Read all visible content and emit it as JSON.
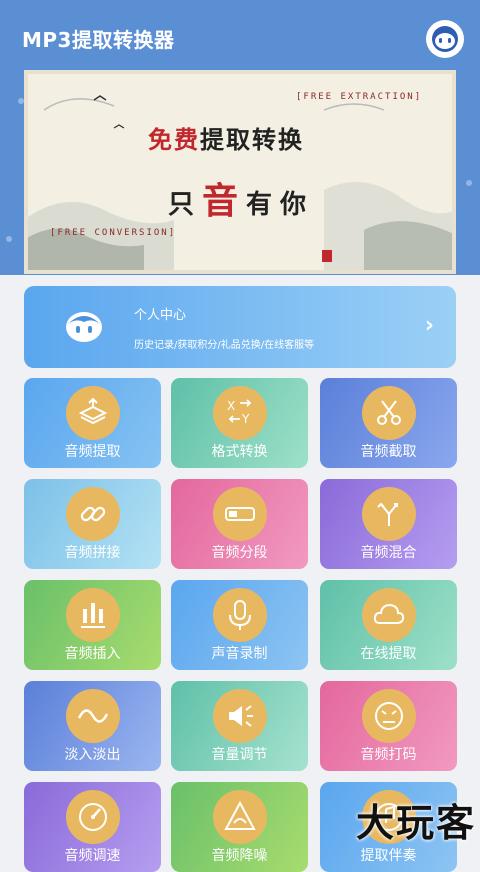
{
  "app": {
    "title": "MP3提取转换器"
  },
  "banner": {
    "tag_top": "[FREE EXTRACTION]",
    "headline_red": "免费",
    "headline_rest": "提取转换",
    "sub_pre": "只",
    "sub_big": "音",
    "sub_post": "有你",
    "tag_bottom": "[FREE CONVERSION]"
  },
  "profile": {
    "title": "个人中心",
    "subtitle": "历史记录/获取积分/礼品兑换/在线客服等",
    "arrow": "›"
  },
  "tiles": [
    {
      "label": "音频提取",
      "icon": "extract-icon",
      "grad": [
        "#5aa6ef",
        "#86c3f2"
      ]
    },
    {
      "label": "格式转换",
      "icon": "format-convert-icon",
      "grad": [
        "#5fc0a8",
        "#9ee0c8"
      ]
    },
    {
      "label": "音频截取",
      "icon": "scissors-icon",
      "grad": [
        "#5b7fd9",
        "#8aa8ee"
      ]
    },
    {
      "label": "音频拼接",
      "icon": "link-icon",
      "grad": [
        "#7cc0e8",
        "#b4e2f4"
      ]
    },
    {
      "label": "音频分段",
      "icon": "segment-icon",
      "grad": [
        "#e4679c",
        "#f19ac1"
      ]
    },
    {
      "label": "音频混合",
      "icon": "merge-icon",
      "grad": [
        "#8a6ad9",
        "#b59ef0"
      ]
    },
    {
      "label": "音频插入",
      "icon": "insert-icon",
      "grad": [
        "#6ac06a",
        "#a8dc6e"
      ]
    },
    {
      "label": "声音录制",
      "icon": "microphone-icon",
      "grad": [
        "#5aa6ef",
        "#8dc4f2"
      ]
    },
    {
      "label": "在线提取",
      "icon": "cloud-icon",
      "grad": [
        "#5fc0a8",
        "#9ee0c8"
      ]
    },
    {
      "label": "淡入淡出",
      "icon": "wave-icon",
      "grad": [
        "#5b7fd9",
        "#9bb6f0"
      ]
    },
    {
      "label": "音量调节",
      "icon": "volume-icon",
      "grad": [
        "#5fc0a8",
        "#a6e2cf"
      ]
    },
    {
      "label": "音频打码",
      "icon": "mask-icon",
      "grad": [
        "#e4679c",
        "#f19ac1"
      ]
    },
    {
      "label": "音频调速",
      "icon": "speed-icon",
      "grad": [
        "#8a6ad9",
        "#b59ef0"
      ]
    },
    {
      "label": "音频降噪",
      "icon": "noise-reduce-icon",
      "grad": [
        "#6ac06a",
        "#a8dc6e"
      ]
    },
    {
      "label": "提取伴奏",
      "icon": "accompaniment-icon",
      "grad": [
        "#5aa6ef",
        "#8dc4f2"
      ]
    }
  ],
  "watermark": "大玩客"
}
